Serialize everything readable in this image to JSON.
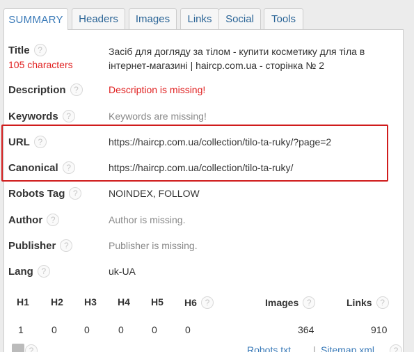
{
  "tabs": [
    {
      "label": "SUMMARY"
    },
    {
      "label": "Headers"
    },
    {
      "label": "Images"
    },
    {
      "label": "Links"
    },
    {
      "label": "Social"
    },
    {
      "label": "Tools"
    }
  ],
  "help_glyph": "?",
  "summary": {
    "title": {
      "label": "Title",
      "chars": "105 characters",
      "value": "Засіб для догляду за тілом - купити косметику для тіла в інтернет-магазині | haircp.com.ua - сторінка № 2"
    },
    "description": {
      "label": "Description",
      "value": "Description is missing!"
    },
    "keywords": {
      "label": "Keywords",
      "value": "Keywords are missing!"
    },
    "url": {
      "label": "URL",
      "value": "https://haircp.com.ua/collection/tilo-ta-ruky/?page=2"
    },
    "canonical": {
      "label": "Canonical",
      "value": "https://haircp.com.ua/collection/tilo-ta-ruky/"
    },
    "robots": {
      "label": "Robots Tag",
      "value": "NOINDEX, FOLLOW"
    },
    "author": {
      "label": "Author",
      "value": "Author is missing."
    },
    "publisher": {
      "label": "Publisher",
      "value": "Publisher is missing."
    },
    "lang": {
      "label": "Lang",
      "value": "uk-UA"
    }
  },
  "headings": {
    "columns": [
      "H1",
      "H2",
      "H3",
      "H4",
      "H5",
      "H6",
      "Images",
      "Links"
    ],
    "values": [
      "1",
      "0",
      "0",
      "0",
      "0",
      "0",
      "364",
      "910"
    ]
  },
  "footer": {
    "robots_link": "Robots.txt",
    "separator": "|",
    "sitemap_link": "Sitemap.xml"
  },
  "colors": {
    "highlight": "#d01c1c",
    "error": "#e02020",
    "link": "#3a7ab8"
  }
}
